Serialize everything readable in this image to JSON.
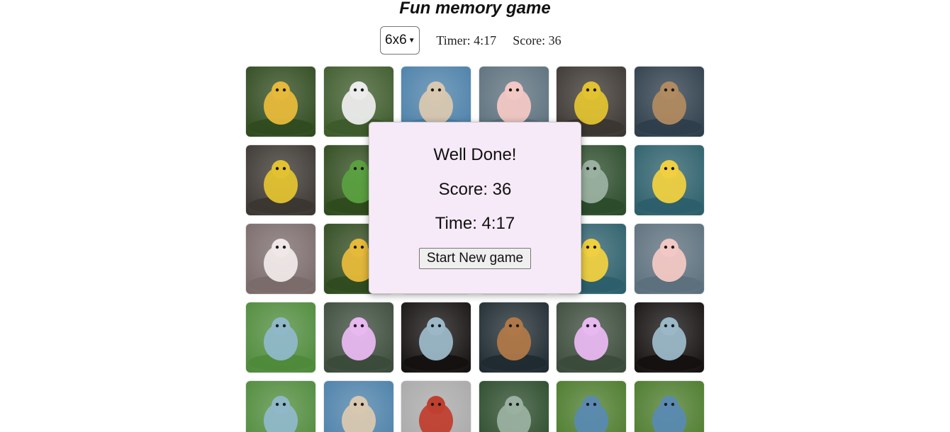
{
  "title": "Fun memory game",
  "controls": {
    "size_selected": "6x6",
    "timer_text": "Timer: 4:17",
    "score_text": "Score: 36"
  },
  "board": {
    "cards": [
      {
        "subject": "yellow-chick",
        "bg": "#2f4a1e",
        "fg": "#e7b93a"
      },
      {
        "subject": "white-fluffy-creature",
        "bg": "#3d5a2a",
        "fg": "#ececec"
      },
      {
        "subject": "kittens",
        "bg": "#4a7fa8",
        "fg": "#d9c8b0"
      },
      {
        "subject": "cat-girl-hoodie",
        "bg": "#5b6f7c",
        "fg": "#f2c8c4"
      },
      {
        "subject": "child-trumpet",
        "bg": "#3a3530",
        "fg": "#e2c230"
      },
      {
        "subject": "samurai-cat",
        "bg": "#2d3d4a",
        "fg": "#b08a60"
      },
      {
        "subject": "child-trumpet",
        "bg": "#3a3530",
        "fg": "#e2c230"
      },
      {
        "subject": "chameleon",
        "bg": "#2e4a1c",
        "fg": "#5aa040"
      },
      {
        "subject": "hidden",
        "bg": "#e8e8e8",
        "fg": "#e8e8e8"
      },
      {
        "subject": "hidden",
        "bg": "#e8e8e8",
        "fg": "#e8e8e8"
      },
      {
        "subject": "hedgehog-green",
        "bg": "#2a4a2a",
        "fg": "#9ab0a0"
      },
      {
        "subject": "pink-crest-chick",
        "bg": "#2b5e6a",
        "fg": "#f0d040"
      },
      {
        "subject": "kittens-pink",
        "bg": "#7a6a6a",
        "fg": "#f0e8e8"
      },
      {
        "subject": "yellow-chick",
        "bg": "#2f4a1e",
        "fg": "#e7b93a"
      },
      {
        "subject": "hidden",
        "bg": "#e8e8e8",
        "fg": "#e8e8e8"
      },
      {
        "subject": "hidden",
        "bg": "#e8e8e8",
        "fg": "#e8e8e8"
      },
      {
        "subject": "pink-crest-chick",
        "bg": "#2b5e6a",
        "fg": "#f0d040"
      },
      {
        "subject": "cat-girl-hoodie",
        "bg": "#5b6f7c",
        "fg": "#f2c8c4"
      },
      {
        "subject": "blue-bird",
        "bg": "#4e8a3a",
        "fg": "#8fb8c8"
      },
      {
        "subject": "pink-fluffy",
        "bg": "#3a4a3a",
        "fg": "#e8b8f0"
      },
      {
        "subject": "rabbit-sorcerer",
        "bg": "#141010",
        "fg": "#9bb8c8"
      },
      {
        "subject": "brown-fluffy",
        "bg": "#1e2a30",
        "fg": "#b07848"
      },
      {
        "subject": "pink-fluffy",
        "bg": "#3a4a3a",
        "fg": "#e8b8f0"
      },
      {
        "subject": "rabbit-sorcerer",
        "bg": "#141010",
        "fg": "#9bb8c8"
      },
      {
        "subject": "blue-bird",
        "bg": "#4e8a3a",
        "fg": "#8fb8c8"
      },
      {
        "subject": "kittens",
        "bg": "#4a7fa8",
        "fg": "#d9c8b0"
      },
      {
        "subject": "elf-red-hat",
        "bg": "#a8a8a8",
        "fg": "#c04030"
      },
      {
        "subject": "hedgehog-green",
        "bg": "#2a4a2a",
        "fg": "#9ab0a0"
      },
      {
        "subject": "blue-creature",
        "bg": "#4a7a2a",
        "fg": "#5a8ab0"
      },
      {
        "subject": "blue-creature",
        "bg": "#4a7a2a",
        "fg": "#5a8ab0"
      }
    ]
  },
  "modal": {
    "title": "Well Done!",
    "score_text": "Score: 36",
    "time_text": "Time: 4:17",
    "button_label": "Start New game"
  }
}
